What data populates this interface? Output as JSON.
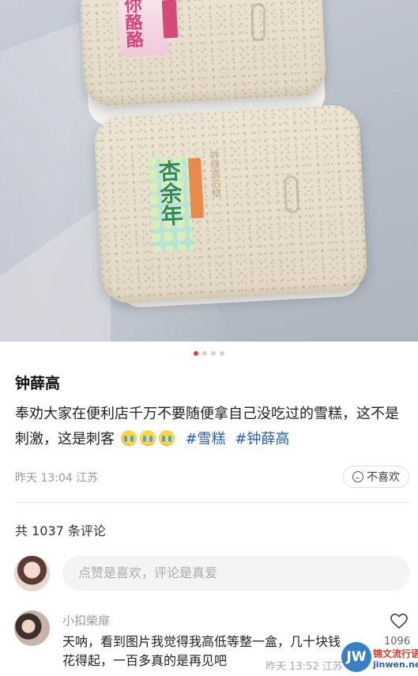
{
  "photo": {
    "top_label": "你酪酪",
    "green_label": "杏余年",
    "emboss": "钟薛高的糕"
  },
  "carousel": {
    "count": 4,
    "active": 1
  },
  "post": {
    "title": "钟薛高",
    "body": "奉劝大家在便利店千万不要随便拿自己没吃过的雪糕，这不是刺激，这是刺客",
    "emoji": "😭",
    "tags": [
      "#雪糕",
      "#钟薛高"
    ],
    "time": "昨天 13:04",
    "location": "江苏",
    "dislike_label": "不喜欢"
  },
  "comments": {
    "count_label": "共 1037 条评论",
    "input_placeholder": "点赞是喜欢，评论是真爱",
    "items": [
      {
        "user": "小扣柴扉",
        "text": "天呐，看到图片我觉得我高低等整一盒，几十块钱花得起，一百多真的是再见吧",
        "time": "昨天 13:52 江苏",
        "likes": "1096"
      }
    ]
  },
  "watermark": {
    "logo": "JW",
    "cn": "锦文流行语",
    "en": "jinwen.net"
  }
}
